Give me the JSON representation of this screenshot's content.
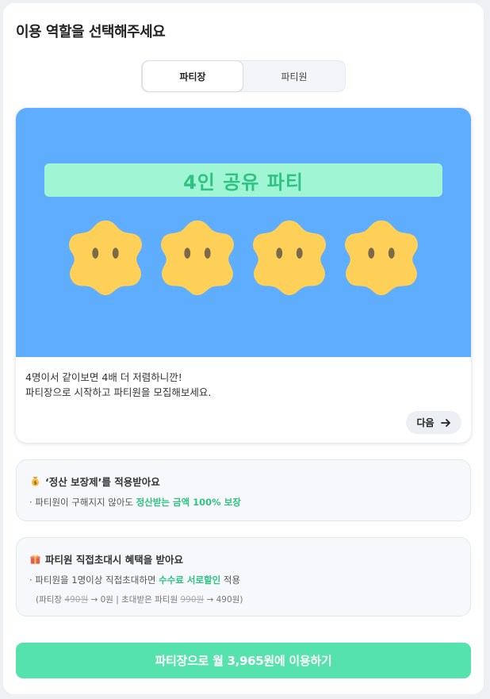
{
  "page": {
    "title": "이용 역할을 선택해주세요"
  },
  "tabs": [
    {
      "label": "파티장",
      "active": true
    },
    {
      "label": "파티원",
      "active": false
    }
  ],
  "banner": {
    "label": "4인 공유 파티",
    "background_color": "#5fadfe",
    "label_box_color": "#a0f5d5",
    "label_text_color": "#2fc281",
    "character_color": "#ffd057"
  },
  "card": {
    "desc_line1": "4명이서 같이보면 4배 더 저렴하니깐!",
    "desc_line2": "파티장으로 시작하고 파티원을 모집해보세요.",
    "next_label": "다음"
  },
  "info1": {
    "icon": "money-bag-icon",
    "title": "‘정산 보장제’를 적용받아요",
    "line_prefix": "· 파티원이 구해지지 않아도 ",
    "line_highlight": "정산받는 금액 100% 보장"
  },
  "info2": {
    "icon": "gift-icon",
    "title": "파티원 직접초대시 혜택을 받아요",
    "line_prefix": "· 파티원을 1명이상 직접초대하면 ",
    "line_highlight": "수수료 서로할인",
    "line_suffix": " 적용",
    "sub_open": "(파티장 ",
    "sub_old1": "490원",
    "sub_mid": " → 0원 | 초대받은 파티원 ",
    "sub_old2": "990원",
    "sub_close": " → 490원)"
  },
  "cta": {
    "label": "파티장으로 월 3,965원에 이용하기",
    "color": "#56e2ad"
  }
}
